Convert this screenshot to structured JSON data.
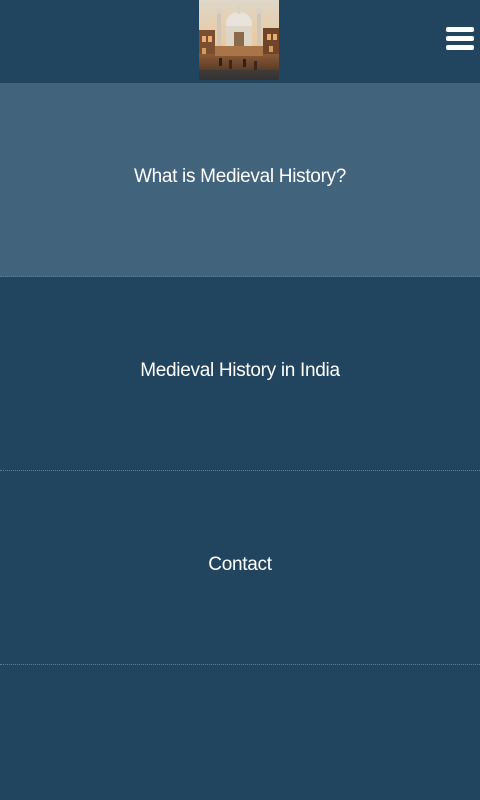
{
  "header": {
    "logo_alt": "Medieval History",
    "menu_icon": "hamburger-menu-icon"
  },
  "nav": {
    "items": [
      {
        "label": "What is Medieval History?",
        "active": true
      },
      {
        "label": "Medieval History in India",
        "active": false
      },
      {
        "label": "Contact",
        "active": false
      }
    ]
  },
  "colors": {
    "background": "#22455f",
    "active_item": "#41637c",
    "text": "#ffffff",
    "divider": "#5f7c92"
  }
}
